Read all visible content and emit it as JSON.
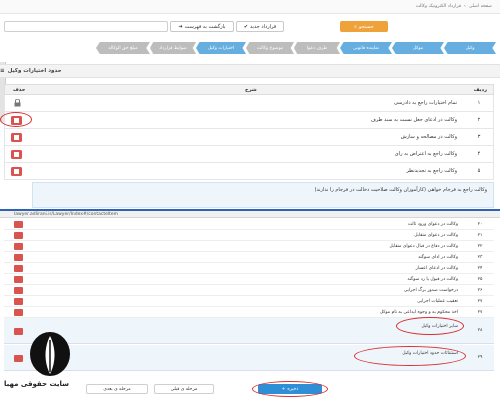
{
  "breadcrumb": [
    "صفحه اصلی",
    "قرارداد الکترونیک وکالت"
  ],
  "toolbar": {
    "search_label": "جستجو",
    "new_contract_label": "قرارداد جدید",
    "back_to_list_label": "بازگشت به فهرست"
  },
  "steps": [
    {
      "label": "وکیل",
      "state": "done"
    },
    {
      "label": "موکل",
      "state": "done"
    },
    {
      "label": "نماینده قانونی",
      "state": "done"
    },
    {
      "label": "طرف دعوا",
      "state": "todo"
    },
    {
      "label": "موضوع وکالت",
      "state": "todo"
    },
    {
      "label": "اختیارات وکیل",
      "state": "done"
    },
    {
      "label": "ضوابط قرارداد",
      "state": "todo"
    },
    {
      "label": "مبلغ حق الوکاله",
      "state": "todo"
    }
  ],
  "panel_title": "حدود اختیارات وکیل",
  "table": {
    "headers": {
      "index": "ردیف",
      "description": "شرح",
      "delete": "حذف"
    },
    "rows": [
      {
        "index": "۱",
        "text": "تمام اختیارات راجع به دادرسی",
        "action": "lock"
      },
      {
        "index": "۲",
        "text": "وکالت در ادعای جعل نسبت به سند طرف",
        "action": "delete"
      },
      {
        "index": "۳",
        "text": "وکالت در مصالحه و سازش",
        "action": "delete"
      },
      {
        "index": "۴",
        "text": "وکالت راجع به اعتراض به رای",
        "action": "delete"
      },
      {
        "index": "۵",
        "text": "وکالت راجع به تجدیدنظر",
        "action": "delete"
      }
    ],
    "note": "وکالت راجع به فرجام خواهی (کارآموزان وکالت صلاحیت دخالت در فرجام را ندارند)"
  },
  "second_screen": {
    "url": "lawyer.adlirani.ir/Lawyer/Index#/contacteltem",
    "rows": [
      {
        "index": "۲۰",
        "text": "وکالت در دعوای ورود ثالث"
      },
      {
        "index": "۲۱",
        "text": "وکالت در دعوای متقابل"
      },
      {
        "index": "۲۲",
        "text": "وکالت در دفاع در قبال دعوای متقابل"
      },
      {
        "index": "۲۳",
        "text": "وکالت در ادای سوگند"
      },
      {
        "index": "۲۴",
        "text": "وکالت در ادعای اعسار"
      },
      {
        "index": "۲۵",
        "text": "وکالت در قبول یا رد سوگند"
      },
      {
        "index": "۲۶",
        "text": "درخواست صدور برگ اجرایی"
      },
      {
        "index": "۲۷",
        "text": "تعقیب عملیات اجرایی"
      },
      {
        "index": "۲۷",
        "text": "اخذ محکوم به و وجوه ایداعی به نام موکل"
      }
    ],
    "custom_rows": [
      {
        "index": "۲۸",
        "text": "سایر اختیارات وکیل"
      },
      {
        "index": "۲۹",
        "text": "استثنائات حدود اختیارات وکیل"
      }
    ],
    "footer": {
      "save_label": "ذخیره",
      "prev_label": "مرحله ی قبلی",
      "next_label": "مرحله ی بعدی"
    }
  },
  "watermark": "سایت حقوقی مهبا",
  "colors": {
    "accent": "#67aee0",
    "search": "#f0a23a",
    "danger": "#d9534f",
    "save": "#2e8fd6"
  }
}
